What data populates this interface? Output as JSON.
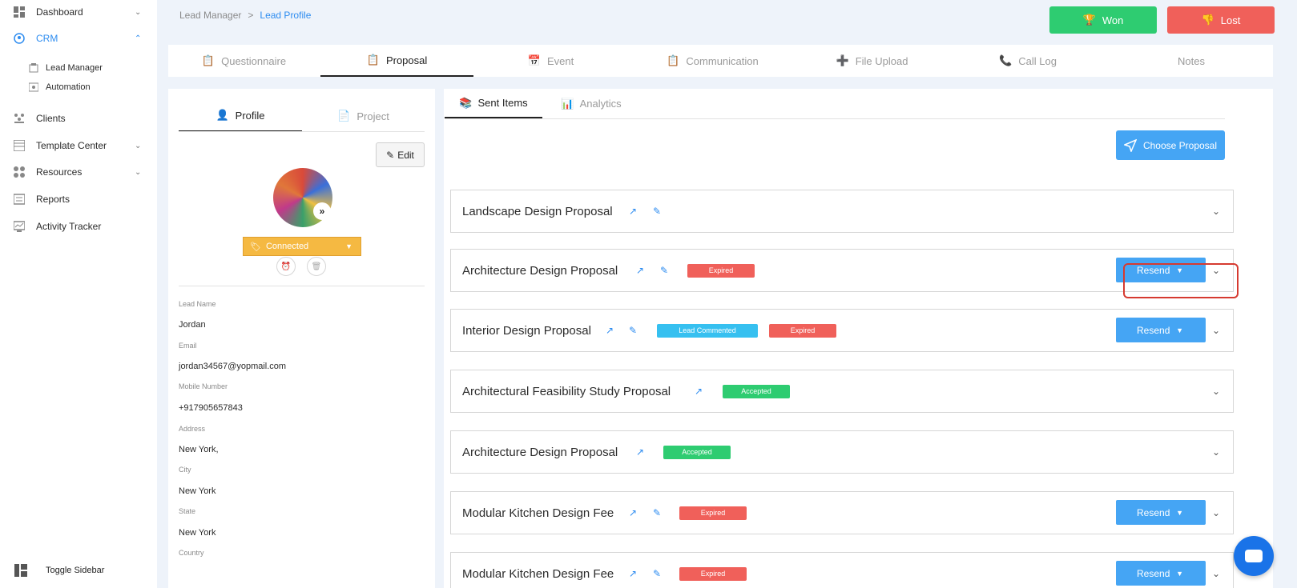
{
  "sidebar": {
    "items": [
      {
        "label": "Dashboard",
        "chevron": "⌄"
      },
      {
        "label": "CRM",
        "chevron": "⌃"
      },
      {
        "label": "Clients"
      },
      {
        "label": "Template Center",
        "chevron": "⌄"
      },
      {
        "label": "Resources",
        "chevron": "⌄"
      },
      {
        "label": "Reports"
      },
      {
        "label": "Activity Tracker"
      }
    ],
    "subitems": [
      {
        "label": "Lead Manager"
      },
      {
        "label": "Automation"
      }
    ],
    "toggle_label": "Toggle Sidebar"
  },
  "breadcrumb": {
    "parent": "Lead Manager",
    "sep": ">",
    "current": "Lead Profile"
  },
  "actions": {
    "won_label": "Won",
    "lost_label": "Lost"
  },
  "tabs": [
    {
      "label": "Questionnaire"
    },
    {
      "label": "Proposal"
    },
    {
      "label": "Event"
    },
    {
      "label": "Communication"
    },
    {
      "label": "File Upload"
    },
    {
      "label": "Call Log"
    },
    {
      "label": "Notes"
    }
  ],
  "profile": {
    "tabs": [
      {
        "label": "Profile"
      },
      {
        "label": "Project"
      }
    ],
    "edit_label": "Edit",
    "status": "Connected",
    "fields": [
      {
        "label": "Lead Name",
        "value": "Jordan"
      },
      {
        "label": "Email",
        "value": "jordan34567@yopmail.com"
      },
      {
        "label": "Mobile Number",
        "value": "+917905657843"
      },
      {
        "label": "Address",
        "value": "New York,"
      },
      {
        "label": "City",
        "value": "New York"
      },
      {
        "label": "State",
        "value": "New York"
      },
      {
        "label": "Country",
        "value": ""
      }
    ]
  },
  "proposals_panel": {
    "tabs": [
      {
        "label": "Sent Items"
      },
      {
        "label": "Analytics"
      }
    ],
    "choose_label": "Choose Proposal",
    "resend_label": "Resend",
    "items": [
      {
        "title": "Landscape Design Proposal",
        "badges": []
      },
      {
        "title": "Architecture Design Proposal",
        "badges": [
          "Expired"
        ]
      },
      {
        "title": "Interior Design Proposal",
        "badges": [
          "Lead Commented",
          "Expired"
        ]
      },
      {
        "title": "Architectural Feasibility Study Proposal",
        "badges": [
          "Accepted"
        ]
      },
      {
        "title": "Architecture Design Proposal",
        "badges": [
          "Accepted"
        ]
      },
      {
        "title": "Modular Kitchen Design Fee",
        "badges": [
          "Expired"
        ]
      },
      {
        "title": "Modular Kitchen Design Fee",
        "badges": [
          "Expired"
        ]
      }
    ]
  },
  "colors": {
    "accent": "#2d8cf0",
    "won": "#2ecc71",
    "lost": "#f0605a",
    "status": "#f5b942"
  }
}
